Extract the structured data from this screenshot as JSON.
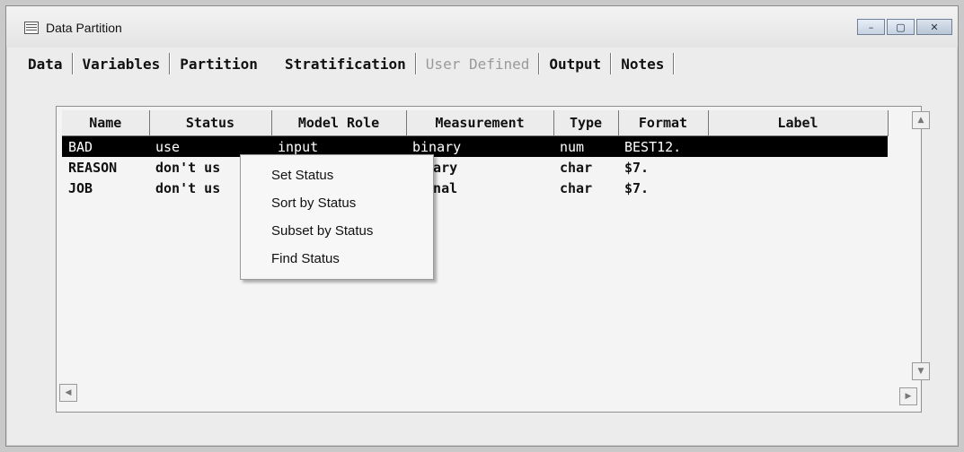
{
  "window": {
    "title": "Data Partition"
  },
  "window_controls": {
    "minimize": "–",
    "maximize": "▢",
    "close": "✕"
  },
  "tabs": [
    {
      "label": "Data",
      "enabled": true
    },
    {
      "label": "Variables",
      "enabled": true
    },
    {
      "label": "Partition",
      "enabled": true
    },
    {
      "label": "Stratification",
      "enabled": true
    },
    {
      "label": "User Defined",
      "enabled": false
    },
    {
      "label": "Output",
      "enabled": true
    },
    {
      "label": "Notes",
      "enabled": true
    }
  ],
  "table": {
    "columns": [
      "Name",
      "Status",
      "Model Role",
      "Measurement",
      "Type",
      "Format",
      "Label"
    ],
    "rows": [
      {
        "name": "BAD",
        "status": "use",
        "model_role": "input",
        "measurement": "binary",
        "type": "num",
        "format": "BEST12.",
        "label": "",
        "selected": true
      },
      {
        "name": "REASON",
        "status": "don't us",
        "model_role": "",
        "measurement": "inary",
        "type": "char",
        "format": "$7.",
        "label": "",
        "selected": false
      },
      {
        "name": "JOB",
        "status": "don't us",
        "model_role": "",
        "measurement": "minal",
        "type": "char",
        "format": "$7.",
        "label": "",
        "selected": false
      }
    ]
  },
  "context_menu": {
    "items": [
      "Set Status",
      "Sort by Status",
      "Subset by Status",
      "Find Status"
    ]
  },
  "icons": {
    "app": "spreadsheet-icon",
    "scroll_up": "▲",
    "scroll_down": "▼",
    "scroll_left": "◀",
    "scroll_right": "▶"
  },
  "colors": {
    "selection_bg": "#000000",
    "selection_fg": "#ffffff",
    "disabled_tab": "#9a9a9a"
  }
}
